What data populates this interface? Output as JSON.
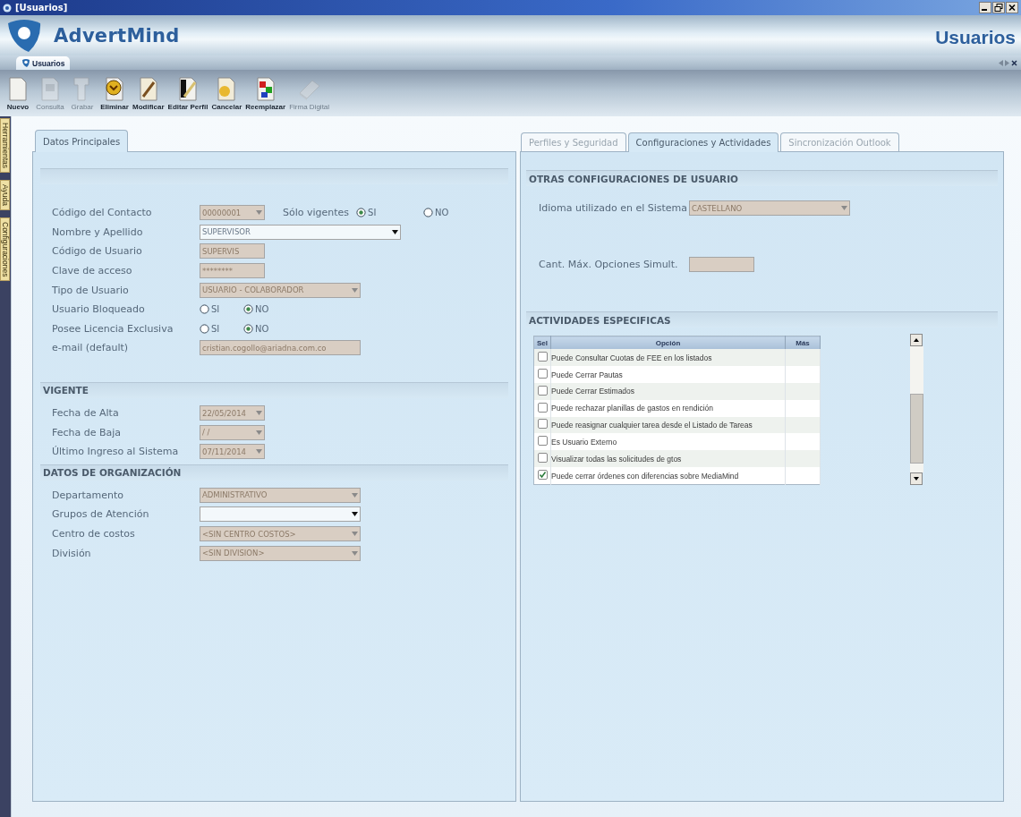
{
  "window": {
    "title": "[Usuarios]"
  },
  "header": {
    "app_name": "AdvertMind",
    "module_title": "Usuarios"
  },
  "doc_tabs": [
    {
      "label": "Usuarios",
      "selected": true
    }
  ],
  "toolbar": [
    {
      "label": "Nuevo",
      "kind": "new",
      "disabled": false
    },
    {
      "label": "Consulta",
      "kind": "query",
      "disabled": true
    },
    {
      "label": "Grabar",
      "kind": "save",
      "disabled": true
    },
    {
      "label": "Eliminar",
      "kind": "delete",
      "disabled": false
    },
    {
      "label": "Modificar",
      "kind": "edit",
      "disabled": false
    },
    {
      "label": "Editar Perfil",
      "kind": "profile",
      "disabled": false
    },
    {
      "label": "Cancelar",
      "kind": "cancel",
      "disabled": false
    },
    {
      "label": "Reemplazar",
      "kind": "replace",
      "disabled": false
    },
    {
      "label": "Firma Digital",
      "kind": "sign",
      "disabled": true
    }
  ],
  "side_tabs": [
    {
      "label": "Herramientas"
    },
    {
      "label": "Ayuda"
    },
    {
      "label": "Configuraciones"
    }
  ],
  "left_panel": {
    "tabs": [
      {
        "label": "Datos Principales",
        "selected": true
      }
    ],
    "main_fields": [
      {
        "label": "Código del Contacto",
        "kind": "short-combo",
        "value": "00000001",
        "disabled": true,
        "extra": {
          "label": "Sólo vigentes",
          "options": [
            {
              "label": "SI",
              "selected": true
            },
            {
              "label": "NO",
              "selected": false
            }
          ]
        }
      },
      {
        "label": "Nombre y Apellido",
        "kind": "wide-combo",
        "value": "SUPERVISOR",
        "disabled": false
      },
      {
        "label": "Código de Usuario",
        "kind": "short-text",
        "value": "SUPERVIS",
        "disabled": true
      },
      {
        "label": "Clave de acceso",
        "kind": "short-text",
        "value": "********",
        "disabled": true
      },
      {
        "label": "Tipo de Usuario",
        "kind": "combo",
        "value": "USUARIO - COLABORADOR",
        "disabled": true
      },
      {
        "label": "Usuario Bloqueado",
        "kind": "radio",
        "options": [
          {
            "label": "SI",
            "selected": false
          },
          {
            "label": "NO",
            "selected": true
          }
        ]
      },
      {
        "label": "Posee Licencia Exclusiva",
        "kind": "radio",
        "options": [
          {
            "label": "SI",
            "selected": false
          },
          {
            "label": "NO",
            "selected": true
          }
        ]
      },
      {
        "label": "e-mail (default)",
        "kind": "text",
        "value": "cristian.cogollo@ariadna.com.co",
        "disabled": true
      }
    ],
    "sections": [
      {
        "title": "VIGENTE",
        "fields": [
          {
            "label": "Fecha de Alta",
            "kind": "short-combo",
            "value": "22/05/2014",
            "disabled": true
          },
          {
            "label": "Fecha de Baja",
            "kind": "short-combo",
            "value": "/ /",
            "disabled": true
          },
          {
            "label": "Último Ingreso al Sistema",
            "kind": "short-combo",
            "value": "07/11/2014",
            "disabled": true
          }
        ]
      },
      {
        "title": "DATOS DE ORGANIZACIÓN",
        "fields": [
          {
            "label": "Departamento",
            "kind": "combo",
            "value": "ADMINISTRATIVO",
            "disabled": true
          },
          {
            "label": "Grupos de Atención",
            "kind": "combo",
            "disabled": false
          },
          {
            "label": "Centro de costos",
            "kind": "combo",
            "value": "<SIN CENTRO COSTOS>",
            "disabled": true
          },
          {
            "label": "División",
            "kind": "combo",
            "value": "<SIN DIVISION>",
            "disabled": true
          }
        ]
      }
    ]
  },
  "right_panel": {
    "tabs": [
      {
        "label": "Perfiles y Seguridad",
        "selected": false
      },
      {
        "label": "Configuraciones y Actividades",
        "selected": true
      },
      {
        "label": "Sincronización Outlook",
        "selected": false
      }
    ],
    "config_section": {
      "title": "OTRAS CONFIGURACIONES DE USUARIO",
      "fields": [
        {
          "label": "Idioma utilizado en el Sistema",
          "kind": "combo",
          "value": "CASTELLANO",
          "disabled": true
        },
        {
          "label": "Cant. Máx. Opciones Simult.",
          "kind": "short-text",
          "disabled": true
        }
      ]
    },
    "activities": {
      "title": "ACTIVIDADES ESPECIFICAS",
      "columns": [
        "Sel",
        "Opción",
        "Más"
      ],
      "rows": [
        {
          "option": "Puede Consultar Cuotas de FEE en los listados",
          "checked": false
        },
        {
          "option": "Puede Cerrar Pautas",
          "checked": false
        },
        {
          "option": "Puede Cerrar Estimados",
          "checked": false
        },
        {
          "option": "Puede rechazar planillas de gastos en rendición",
          "checked": false
        },
        {
          "option": "Puede reasignar cualquier tarea desde el Listado de Tareas",
          "checked": false
        },
        {
          "option": "Es Usuario Externo",
          "checked": false
        },
        {
          "option": "Visualizar todas las solicitudes de gtos",
          "checked": false
        },
        {
          "option": "Puede cerrar órdenes con diferencias sobre MediaMind",
          "checked": true
        }
      ]
    }
  }
}
